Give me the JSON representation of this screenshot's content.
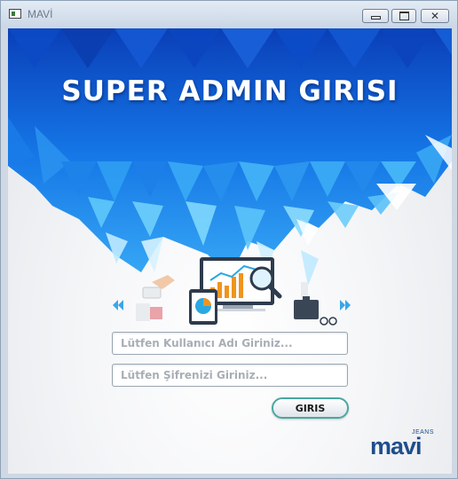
{
  "window": {
    "title": "MAVİ",
    "controls": {
      "minimize": "minimize",
      "maximize": "maximize",
      "close": "✕"
    }
  },
  "banner": {
    "title": "SUPER ADMIN GIRISI",
    "colors": {
      "dark": "#0b56d6",
      "mid": "#1f8ff0",
      "light": "#4fc3fb",
      "pale": "#9fe3ff"
    }
  },
  "illustration": {
    "description_icons": [
      "handshake-icon",
      "laptop-chart-icon",
      "tablet-pie-icon",
      "magnifier-icon",
      "briefcase-icon",
      "glasses-icon"
    ],
    "left_arrows": "«",
    "right_arrows": "»"
  },
  "form": {
    "username_placeholder": "Lütfen Kullanıcı Adı Giriniz...",
    "password_placeholder": "Lütfen Şifrenizi Giriniz...",
    "username_value": "",
    "password_value": "",
    "login_label": "GIRIS"
  },
  "brand": {
    "small": "JEANS",
    "name": "mavi",
    "color": "#1f4e8c"
  }
}
